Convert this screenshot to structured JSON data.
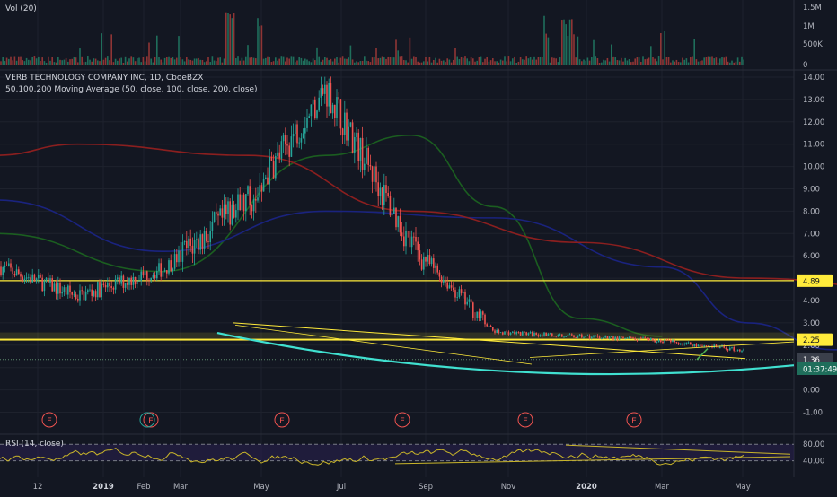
{
  "colors": {
    "background": "#131722",
    "grid": "#1e222d",
    "up": "#26a69a",
    "down": "#ef5350",
    "ma50": "#1b5e20",
    "ma100": "#1a237e",
    "ma200": "#8b1f1f",
    "yellow": "#ffeb3b",
    "cyan": "#40e0d0",
    "rsi": "#c9b52a",
    "rsi_band": "#2a2050"
  },
  "volume_pane": {
    "title": "Vol (20)",
    "ticks": [
      "1.5M",
      "1M",
      "500K",
      "0"
    ]
  },
  "price_pane": {
    "title": "VERB TECHNOLOGY COMPANY INC, 1D, CboeBZX",
    "indicator": "50,100,200 Moving Average (50, close, 100, close, 200, close)",
    "ticks": [
      "14.00",
      "13.00",
      "12.00",
      "11.00",
      "10.00",
      "9.00",
      "8.00",
      "7.00",
      "6.00",
      "5.00",
      "4.00",
      "3.00",
      "2.00",
      "1.00",
      "0.00",
      "-1.00"
    ],
    "price_labels": [
      {
        "text": "4.89",
        "value": 4.89,
        "style": "yellow"
      },
      {
        "text": "2.25",
        "value": 2.25,
        "style": "yellow"
      },
      {
        "text": "1.36",
        "value": 1.36,
        "style": "grey"
      },
      {
        "text": "01:37:49",
        "value": 0.95,
        "style": "teal"
      }
    ],
    "earnings_marker": "E",
    "earnings_count": 6
  },
  "rsi_pane": {
    "title": "RSI (14, close)",
    "ticks": [
      "80.00",
      "40.00"
    ]
  },
  "time_axis": [
    "12",
    "2019",
    "Feb",
    "Mar",
    "May",
    "Jul",
    "Sep",
    "Nov",
    "2020",
    "Mar",
    "May"
  ],
  "chart_data": {
    "type": "candlestick",
    "title": "VERB TECHNOLOGY COMPANY INC, 1D, CboeBZX",
    "x_range": [
      "2018-11",
      "2020-05"
    ],
    "ylim": [
      -1.0,
      14.0
    ],
    "horizontal_levels": [
      4.89,
      2.25,
      1.36
    ],
    "price_path": [
      {
        "x": "2018-11",
        "y": 5.6
      },
      {
        "x": "2018-12",
        "y": 4.2
      },
      {
        "x": "2019-01",
        "y": 5.4
      },
      {
        "x": "2019-02",
        "y": 8.5
      },
      {
        "x": "2019-03",
        "y": 13.5
      },
      {
        "x": "2019-04",
        "y": 6.5
      },
      {
        "x": "2019-05",
        "y": 2.6
      },
      {
        "x": "2019-07",
        "y": 2.2
      },
      {
        "x": "2019-09",
        "y": 1.3
      },
      {
        "x": "2019-11",
        "y": 1.1
      },
      {
        "x": "2020-01",
        "y": 1.8
      },
      {
        "x": "2020-03",
        "y": 1.4
      },
      {
        "x": "2020-04",
        "y": 1.36
      }
    ],
    "moving_averages": [
      {
        "name": "50",
        "values": [
          {
            "x": "2018-11",
            "y": 7.0
          },
          {
            "x": "2019-01",
            "y": 5.3
          },
          {
            "x": "2019-03",
            "y": 10.5
          },
          {
            "x": "2019-04",
            "y": 11.4
          },
          {
            "x": "2019-05",
            "y": 8.2
          },
          {
            "x": "2019-06",
            "y": 3.2
          },
          {
            "x": "2019-07",
            "y": 2.4
          }
        ]
      },
      {
        "name": "100",
        "values": [
          {
            "x": "2018-11",
            "y": 8.5
          },
          {
            "x": "2019-01",
            "y": 6.2
          },
          {
            "x": "2019-03",
            "y": 8.0
          },
          {
            "x": "2019-05",
            "y": 7.7
          },
          {
            "x": "2019-07",
            "y": 5.5
          },
          {
            "x": "2019-08",
            "y": 3.0
          },
          {
            "x": "2019-09",
            "y": 1.8
          },
          {
            "x": "2019-11",
            "y": 1.4
          },
          {
            "x": "2020-01",
            "y": 1.5
          },
          {
            "x": "2020-04",
            "y": 1.3
          }
        ]
      },
      {
        "name": "200",
        "values": [
          {
            "x": "2018-11",
            "y": 10.5
          },
          {
            "x": "2018-12",
            "y": 11.0
          },
          {
            "x": "2019-02",
            "y": 10.5
          },
          {
            "x": "2019-04",
            "y": 8.0
          },
          {
            "x": "2019-06",
            "y": 6.6
          },
          {
            "x": "2019-08",
            "y": 5.0
          },
          {
            "x": "2019-11",
            "y": 3.8
          },
          {
            "x": "2019-12",
            "y": 2.3
          },
          {
            "x": "2020-01",
            "y": 1.8
          }
        ]
      }
    ]
  }
}
